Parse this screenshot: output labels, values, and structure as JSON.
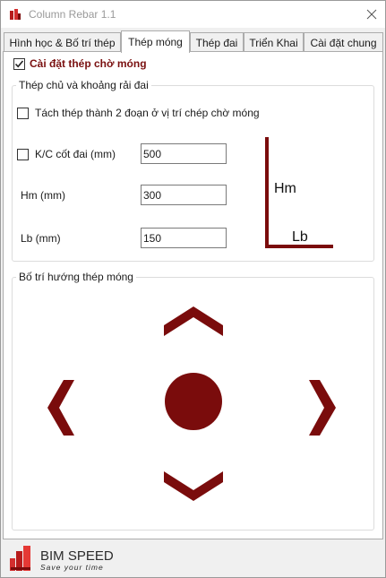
{
  "window": {
    "title": "Column Rebar 1.1"
  },
  "tabs": [
    {
      "label": "Hình học & Bố trí thép"
    },
    {
      "label": "Thép móng"
    },
    {
      "label": "Thép đai"
    },
    {
      "label": "Triển Khai"
    },
    {
      "label": "Cài đặt chung"
    }
  ],
  "main_checkbox": {
    "label": "Cài đặt thép chờ móng",
    "checked": true
  },
  "group_main": {
    "title": "Thép chủ và khoảng rải đai",
    "split_checkbox": {
      "label": "Tách thép thành 2 đoạn ở vị trí chép chờ móng",
      "checked": false
    },
    "kc_checkbox": {
      "label": "K/C cốt đai (mm)",
      "checked": false
    },
    "kc_value": "500",
    "hm_label": "Hm (mm)",
    "hm_value": "300",
    "lb_label": "Lb (mm)",
    "lb_value": "150",
    "diagram": {
      "hm": "Hm",
      "lb": "Lb"
    }
  },
  "group_direction": {
    "title": "Bố trí hướng thép móng"
  },
  "brand": {
    "name": "BIM SPEED",
    "tagline": "Save your time"
  },
  "colors": {
    "accent": "#7a0c0c",
    "title_text": "#9a9a9a"
  },
  "icons": [
    "column-rebar-app-icon",
    "close-icon",
    "checkmark-icon",
    "chevron-up-icon",
    "chevron-down-icon",
    "chevron-left-icon",
    "chevron-right-icon",
    "center-circle-icon",
    "bimspeed-logo-icon"
  ]
}
